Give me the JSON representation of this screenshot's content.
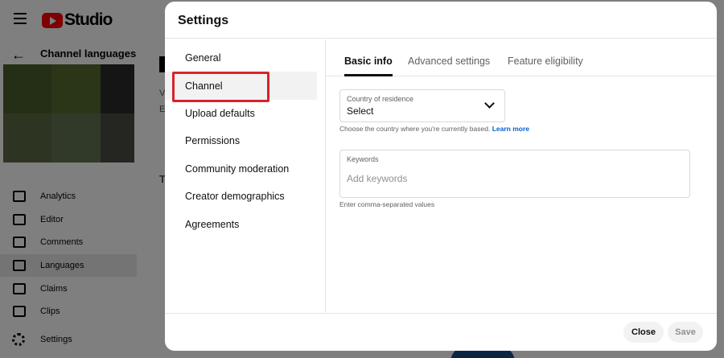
{
  "background": {
    "app_name": "Studio",
    "channel_title": "Channel languages",
    "nav_items": [
      {
        "label": "Analytics",
        "icon": "analytics-icon"
      },
      {
        "label": "Editor",
        "icon": "editor-icon"
      },
      {
        "label": "Comments",
        "icon": "comments-icon"
      },
      {
        "label": "Languages",
        "icon": "languages-icon",
        "active": true
      },
      {
        "label": "Claims",
        "icon": "claims-icon"
      },
      {
        "label": "Clips",
        "icon": "clips-icon"
      }
    ],
    "settings_label": "Settings",
    "fragments": {
      "v": "V",
      "e": "E",
      "t": "T"
    }
  },
  "dialog": {
    "title": "Settings",
    "sidebar": [
      {
        "label": "General"
      },
      {
        "label": "Channel",
        "active": true
      },
      {
        "label": "Upload defaults"
      },
      {
        "label": "Permissions"
      },
      {
        "label": "Community moderation"
      },
      {
        "label": "Creator demographics"
      },
      {
        "label": "Agreements"
      }
    ],
    "tabs": [
      {
        "label": "Basic info",
        "active": true
      },
      {
        "label": "Advanced settings"
      },
      {
        "label": "Feature eligibility"
      }
    ],
    "country": {
      "label": "Country of residence",
      "value": "Select",
      "help": "Choose the country where you're currently based.",
      "learn_more": "Learn more"
    },
    "keywords": {
      "label": "Keywords",
      "placeholder": "Add keywords",
      "help": "Enter comma-separated values"
    },
    "footer": {
      "close_label": "Close",
      "save_label": "Save"
    }
  }
}
